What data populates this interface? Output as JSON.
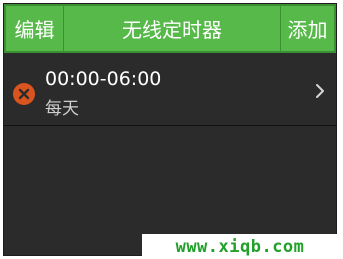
{
  "header": {
    "edit_label": "编辑",
    "title": "无线定时器",
    "add_label": "添加"
  },
  "timers": [
    {
      "time_range": "00:00-06:00",
      "repeat": "每天"
    }
  ],
  "watermark": "www.xiqb.com",
  "colors": {
    "header_bg": "#56b949",
    "screen_bg": "#2b2b2b",
    "delete_icon": "#d9541f",
    "watermark_text": "#22a12a"
  },
  "icons": [
    "delete-circle-icon",
    "chevron-right-icon"
  ]
}
